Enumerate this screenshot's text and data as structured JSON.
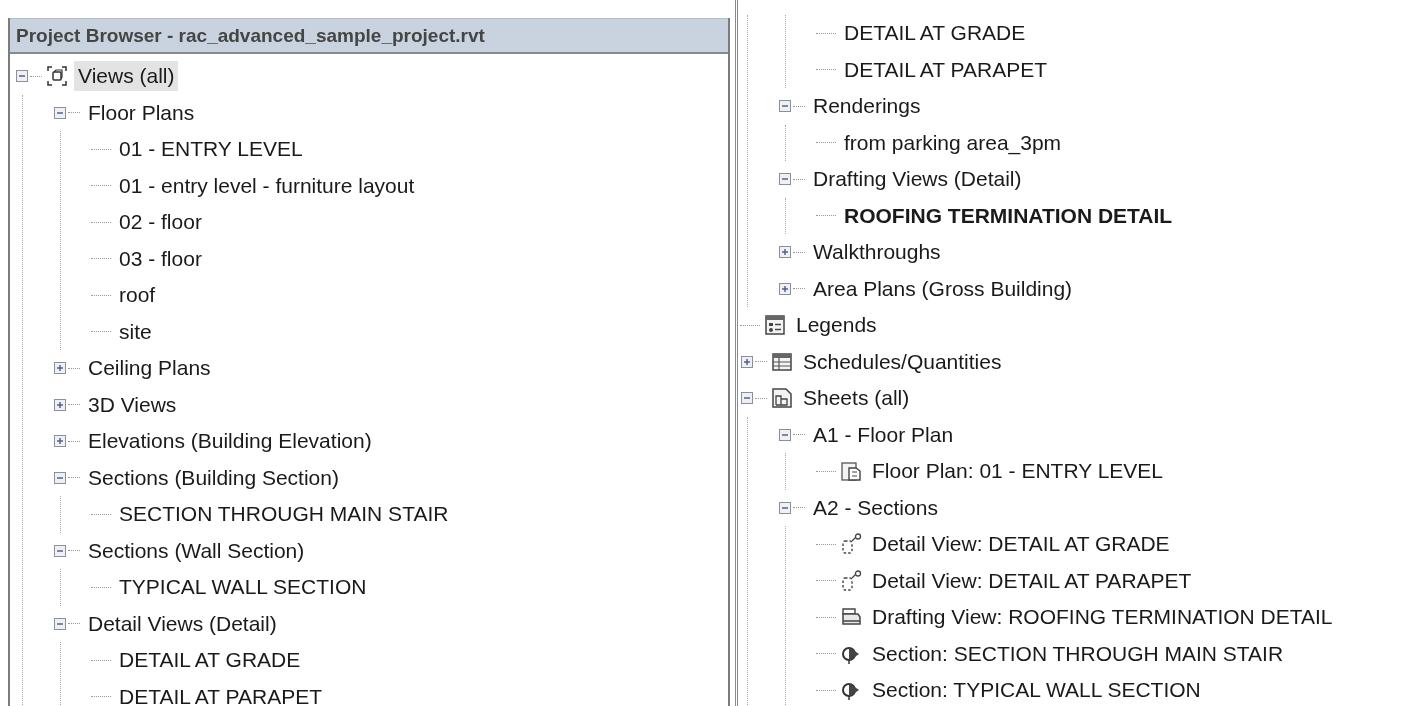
{
  "panels": [
    {
      "title": "Project Browser - rac_advanced_sample_project.rvt",
      "tree": [
        {
          "label": "Views (all)",
          "kind": "views",
          "expanded": true,
          "selected": true,
          "active": false,
          "children": [
            {
              "label": "Floor Plans",
              "expanded": true,
              "selected": false,
              "active": false,
              "children": [
                {
                  "label": "01 - ENTRY LEVEL",
                  "selected": false,
                  "active": false
                },
                {
                  "label": "01 - entry level - furniture layout",
                  "selected": false,
                  "active": false
                },
                {
                  "label": "02 - floor",
                  "selected": false,
                  "active": false
                },
                {
                  "label": "03 - floor",
                  "selected": false,
                  "active": false
                },
                {
                  "label": "roof",
                  "selected": false,
                  "active": false
                },
                {
                  "label": "site",
                  "selected": false,
                  "active": false
                }
              ]
            },
            {
              "label": "Ceiling Plans",
              "expanded": false,
              "selected": false,
              "active": false
            },
            {
              "label": "3D Views",
              "expanded": false,
              "selected": false,
              "active": false
            },
            {
              "label": "Elevations (Building Elevation)",
              "expanded": false,
              "selected": false,
              "active": false
            },
            {
              "label": "Sections (Building Section)",
              "expanded": true,
              "selected": false,
              "active": false,
              "children": [
                {
                  "label": "SECTION THROUGH MAIN STAIR",
                  "selected": false,
                  "active": false
                }
              ]
            },
            {
              "label": "Sections (Wall Section)",
              "expanded": true,
              "selected": false,
              "active": false,
              "children": [
                {
                  "label": "TYPICAL WALL SECTION",
                  "selected": false,
                  "active": false
                }
              ]
            },
            {
              "label": "Detail Views (Detail)",
              "expanded": true,
              "selected": false,
              "active": false,
              "children": [
                {
                  "label": "DETAIL AT GRADE",
                  "selected": false,
                  "active": false
                },
                {
                  "label": "DETAIL AT PARAPET",
                  "selected": false,
                  "active": false
                }
              ]
            }
          ]
        }
      ]
    },
    {
      "tree": [
        {
          "children": [
            {
              "children": [
                {
                  "label": "DETAIL AT GRADE",
                  "selected": false,
                  "active": false
                },
                {
                  "label": "DETAIL AT PARAPET",
                  "selected": false,
                  "active": false
                }
              ]
            },
            {
              "label": "Renderings",
              "expanded": true,
              "selected": false,
              "active": false,
              "children": [
                {
                  "label": "from parking area_3pm",
                  "selected": false,
                  "active": false
                }
              ]
            },
            {
              "label": "Drafting Views (Detail)",
              "expanded": true,
              "selected": false,
              "active": false,
              "children": [
                {
                  "label": "ROOFING TERMINATION DETAIL",
                  "selected": false,
                  "active": true
                }
              ]
            },
            {
              "label": "Walkthroughs",
              "expanded": false,
              "selected": false,
              "active": false
            },
            {
              "label": "Area Plans (Gross Building)",
              "expanded": false,
              "selected": false,
              "active": false
            }
          ]
        },
        {
          "label": "Legends",
          "kind": "legend",
          "selected": false,
          "active": false
        },
        {
          "label": "Schedules/Quantities",
          "kind": "schedule",
          "expanded": false,
          "selected": false,
          "active": false
        },
        {
          "label": "Sheets (all)",
          "kind": "sheet",
          "expanded": true,
          "selected": false,
          "active": false,
          "children": [
            {
              "label": "A1 - Floor Plan",
              "expanded": true,
              "selected": false,
              "active": false,
              "children": [
                {
                  "label": "Floor Plan: 01 - ENTRY LEVEL",
                  "kind": "floorplan",
                  "selected": false,
                  "active": false
                }
              ]
            },
            {
              "label": "A2 - Sections",
              "expanded": true,
              "selected": false,
              "active": false,
              "children": [
                {
                  "label": "Detail View: DETAIL AT GRADE",
                  "kind": "detail",
                  "selected": false,
                  "active": false
                },
                {
                  "label": "Detail View: DETAIL AT PARAPET",
                  "kind": "detail",
                  "selected": false,
                  "active": false
                },
                {
                  "label": "Drafting View: ROOFING TERMINATION DETAIL",
                  "kind": "drafting",
                  "selected": false,
                  "active": false
                },
                {
                  "label": "Section: SECTION THROUGH MAIN STAIR",
                  "kind": "section",
                  "selected": false,
                  "active": false
                },
                {
                  "label": "Section: TYPICAL WALL SECTION",
                  "kind": "section",
                  "selected": false,
                  "active": false
                }
              ]
            }
          ]
        }
      ]
    }
  ]
}
